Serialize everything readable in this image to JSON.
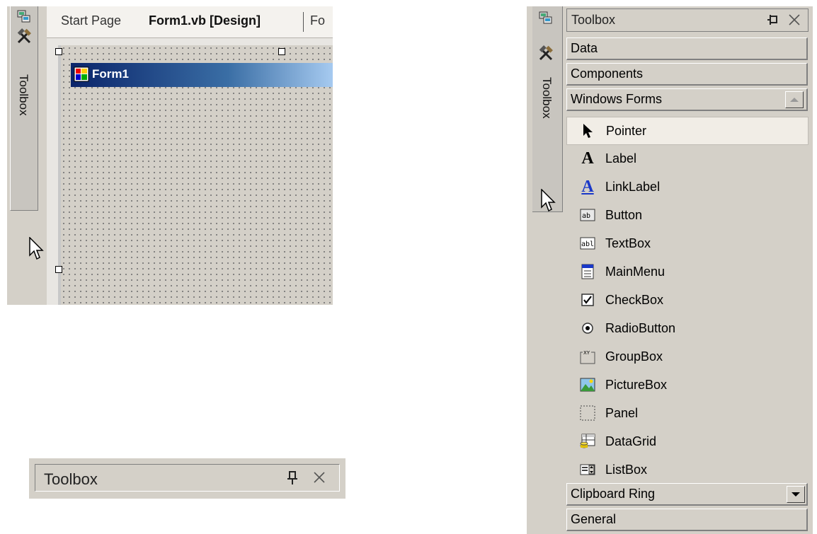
{
  "designer": {
    "sidebar_label": "Toolbox",
    "tabs": [
      {
        "label": "Start Page",
        "active": false
      },
      {
        "label": "Form1.vb [Design]",
        "active": true
      },
      {
        "label": "Fo",
        "active": false
      }
    ],
    "form_title": "Form1"
  },
  "toolbox_strip": {
    "title": "Toolbox"
  },
  "toolbox_panel": {
    "sidebar_label": "Toolbox",
    "title": "Toolbox",
    "sections_top": [
      "Data",
      "Components",
      "Windows Forms"
    ],
    "items": [
      {
        "label": "Pointer",
        "icon": "pointer-icon",
        "selected": true
      },
      {
        "label": "Label",
        "icon": "label-icon"
      },
      {
        "label": "LinkLabel",
        "icon": "linklabel-icon"
      },
      {
        "label": "Button",
        "icon": "button-icon"
      },
      {
        "label": "TextBox",
        "icon": "textbox-icon"
      },
      {
        "label": "MainMenu",
        "icon": "mainmenu-icon"
      },
      {
        "label": "CheckBox",
        "icon": "checkbox-icon"
      },
      {
        "label": "RadioButton",
        "icon": "radiobutton-icon"
      },
      {
        "label": "GroupBox",
        "icon": "groupbox-icon"
      },
      {
        "label": "PictureBox",
        "icon": "picturebox-icon"
      },
      {
        "label": "Panel",
        "icon": "panel-icon"
      },
      {
        "label": "DataGrid",
        "icon": "datagrid-icon"
      },
      {
        "label": "ListBox",
        "icon": "listbox-icon"
      }
    ],
    "sections_bottom": [
      "Clipboard Ring",
      "General"
    ]
  },
  "colors": {
    "chrome": "#d4d0c8",
    "title_gradient_start": "#0a246a",
    "title_gradient_end": "#a6caf0"
  }
}
